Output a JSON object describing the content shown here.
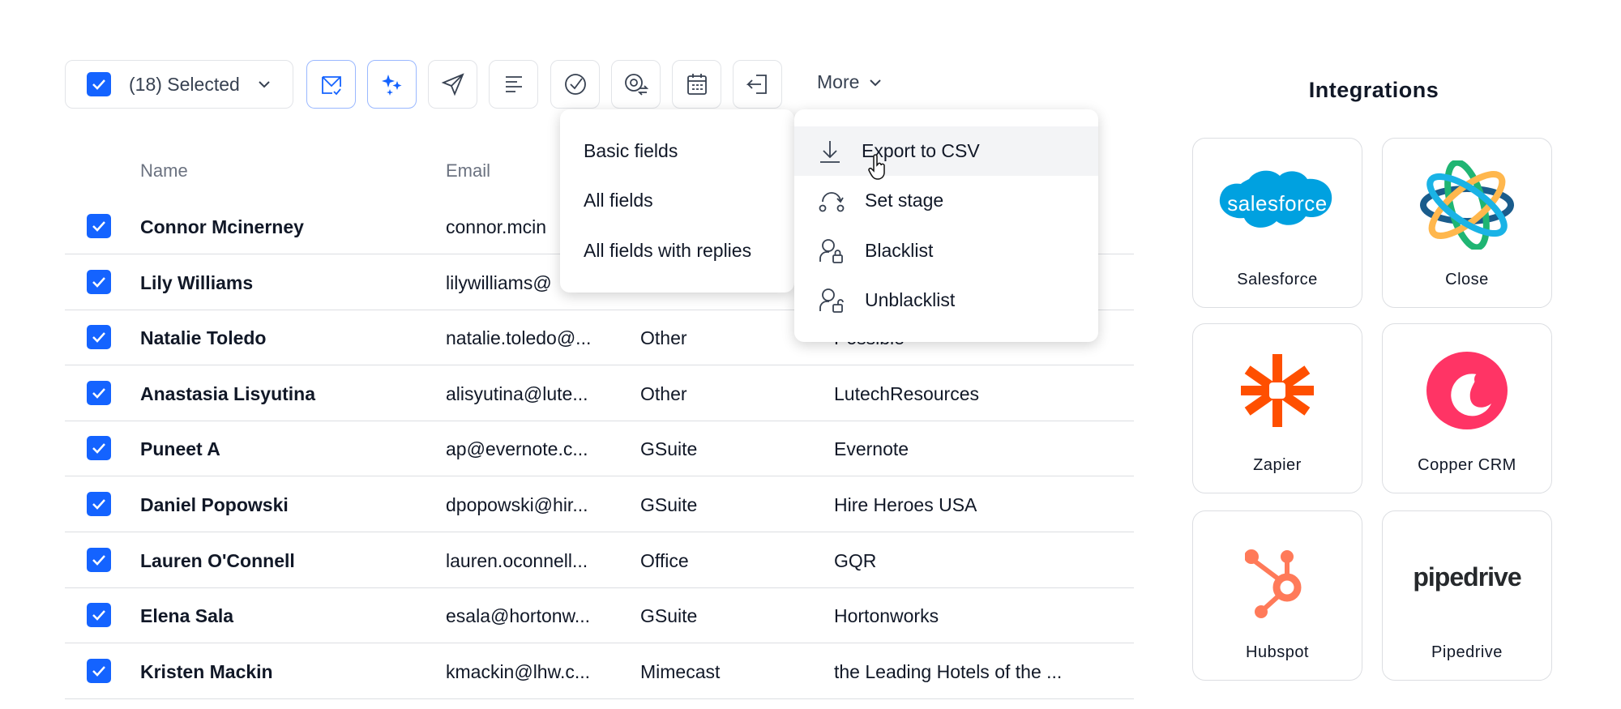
{
  "toolbar": {
    "selected_label": "(18) Selected",
    "more_label": "More",
    "icons": [
      "email-check-icon",
      "sparkles-icon",
      "send-icon",
      "align-left-icon",
      "check-circle-icon",
      "email-swap-icon",
      "calendar-icon",
      "exit-icon"
    ]
  },
  "table": {
    "headers": [
      "Name",
      "Email"
    ],
    "rows": [
      {
        "name": "Connor Mcinerney",
        "email": "connor.mcin",
        "type": "",
        "company": ""
      },
      {
        "name": "Lily Williams",
        "email": "lilywilliams@",
        "type": "",
        "company": ""
      },
      {
        "name": "Natalie Toledo",
        "email": "natalie.toledo@...",
        "type": "Other",
        "company": "Possible"
      },
      {
        "name": "Anastasia Lisyutina",
        "email": "alisyutina@lute...",
        "type": "Other",
        "company": "LutechResources"
      },
      {
        "name": "Puneet A",
        "email": "ap@evernote.c...",
        "type": "GSuite",
        "company": "Evernote"
      },
      {
        "name": "Daniel Popowski",
        "email": "dpopowski@hir...",
        "type": "GSuite",
        "company": "Hire Heroes USA"
      },
      {
        "name": "Lauren O'Connell",
        "email": "lauren.oconnell...",
        "type": "Office",
        "company": "GQR"
      },
      {
        "name": "Elena Sala",
        "email": "esala@hortonw...",
        "type": "GSuite",
        "company": "Hortonworks"
      },
      {
        "name": "Kristen Mackin",
        "email": "kmackin@lhw.c...",
        "type": "Mimecast",
        "company": "the Leading Hotels of the ..."
      }
    ]
  },
  "export_submenu": [
    "Basic fields",
    "All fields",
    "All fields with replies"
  ],
  "more_menu": [
    {
      "label": "Export to CSV",
      "icon": "download-icon"
    },
    {
      "label": "Set stage",
      "icon": "stage-icon"
    },
    {
      "label": "Blacklist",
      "icon": "user-lock-icon"
    },
    {
      "label": "Unblacklist",
      "icon": "user-unlock-icon"
    }
  ],
  "integrations": {
    "title": "Integrations",
    "items": [
      {
        "name": "Salesforce",
        "logo_text": "salesforce"
      },
      {
        "name": "Close"
      },
      {
        "name": "Zapier"
      },
      {
        "name": "Copper CRM"
      },
      {
        "name": "Hubspot"
      },
      {
        "name": "Pipedrive",
        "logo_text": "pipedrive"
      }
    ]
  },
  "colors": {
    "accent": "#1463ff",
    "salesforce": "#00a1e0",
    "zapier": "#ff4f00",
    "copper": "#ff3465",
    "hubspot": "#ff7a59"
  }
}
